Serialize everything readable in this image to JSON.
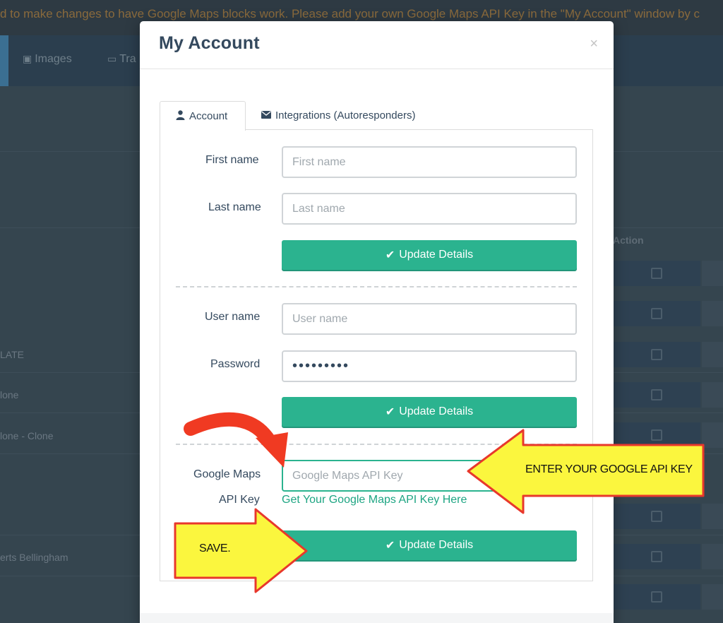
{
  "background": {
    "banner_text": "d to make changes to have Google Maps blocks work. Please add your own Google Maps API Key in the \"My Account\" window by c",
    "nav": [
      {
        "icon": "image-icon",
        "label": "Images"
      },
      {
        "icon": "folder-icon",
        "label": "Tra"
      }
    ],
    "column_header": "Action",
    "rows": [
      "LATE",
      "lone",
      "lone - Clone",
      "erts Bellingham"
    ]
  },
  "modal": {
    "title": "My Account",
    "close_glyph": "×",
    "tabs": [
      {
        "label": "Account",
        "icon": "user-icon",
        "active": true
      },
      {
        "label": "Integrations (Autoresponders)",
        "icon": "envelope-icon",
        "active": false
      }
    ],
    "form": {
      "first_name": {
        "label": "First name",
        "placeholder": "First name",
        "value": ""
      },
      "last_name": {
        "label": "Last name",
        "placeholder": "Last name",
        "value": ""
      },
      "user_name": {
        "label": "User name",
        "placeholder": "User name",
        "value": ""
      },
      "password": {
        "label": "Password",
        "value": "•••••••••"
      },
      "google_maps": {
        "label_line1": "Google Maps",
        "label_line2": "API Key",
        "placeholder": "Google Maps API Key",
        "value": "",
        "link_text": "Get Your Google Maps API Key Here"
      },
      "update_label": "Update Details"
    }
  },
  "annotations": {
    "enter_key": "ENTER YOUR GOOGLE API KEY",
    "save": "SAVE.",
    "arrow_fill": "#fbf63e",
    "arrow_border": "#e8382c",
    "red_arrow": "#f03a22"
  },
  "colors": {
    "accent": "#2bb38f",
    "title": "#34495e",
    "link": "#1ea583"
  }
}
